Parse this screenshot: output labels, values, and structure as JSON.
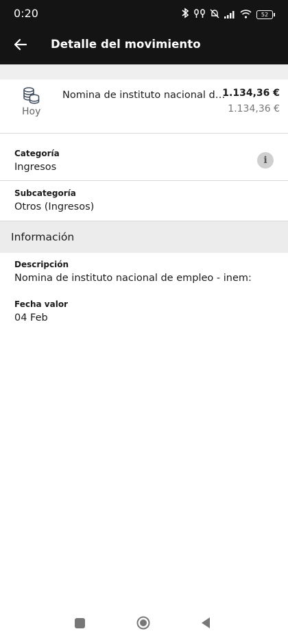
{
  "status": {
    "time": "0:20",
    "battery": "52"
  },
  "header": {
    "title": "Detalle del movimiento"
  },
  "transaction": {
    "icon": "coins-icon",
    "day": "Hoy",
    "description": "Nomina de instituto nacional de e...",
    "amount": "1.134,36 €",
    "amount_secondary": "1.134,36 €"
  },
  "category": {
    "label": "Categoría",
    "value": "Ingresos"
  },
  "subcategory": {
    "label": "Subcategoría",
    "value": "Otros (Ingresos)"
  },
  "info_section": {
    "title": "Información"
  },
  "description": {
    "label": "Descripción",
    "value": "Nomina de instituto nacional de empleo - inem:"
  },
  "value_date": {
    "label": "Fecha valor",
    "value": "04 Feb"
  }
}
